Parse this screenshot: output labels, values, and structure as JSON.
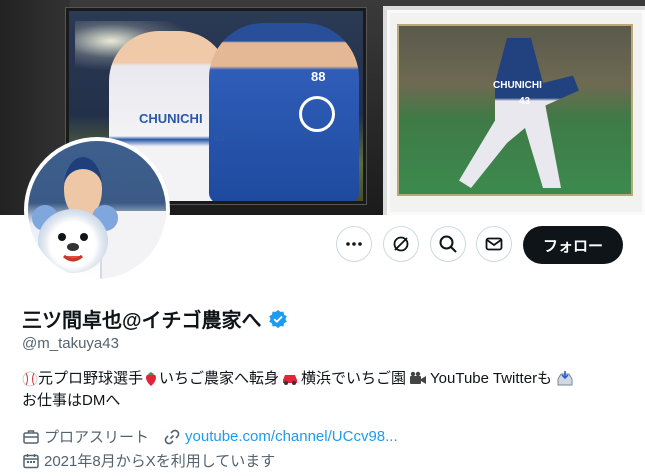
{
  "profile": {
    "display_name": "三ツ間卓也@イチゴ農家へ",
    "handle": "@m_takuya43",
    "bio_line1": {
      "seg1": "元プロ野球選手",
      "seg2": "いちご農家へ転身",
      "seg3": "横浜でいちご園",
      "seg4": "YouTube Twitterも"
    },
    "bio_line2": "お仕事はDMへ",
    "category": "プロアスリート",
    "website": "youtube.com/channel/UCcv98...",
    "joined": "2021年8月からXを利用しています"
  },
  "actions": {
    "follow_label": "フォロー"
  },
  "banner": {
    "left_jersey_text": "CHUNICHI",
    "right_jersey_text": "CHUNICHI",
    "jersey_number_a": "43",
    "jersey_number_b": "88",
    "jersey_number_c": "43"
  },
  "colors": {
    "follow_bg": "#0f1419",
    "verified": "#1d9bf0",
    "link": "#1d9bf0",
    "muted_text": "#536471"
  },
  "icons": [
    "more-icon",
    "grok-icon",
    "search-icon",
    "mail-icon",
    "verified-badge-icon",
    "baseball-icon",
    "strawberry-icon",
    "car-icon",
    "camera-icon",
    "inbox-icon",
    "briefcase-icon",
    "link-icon",
    "calendar-icon"
  ]
}
